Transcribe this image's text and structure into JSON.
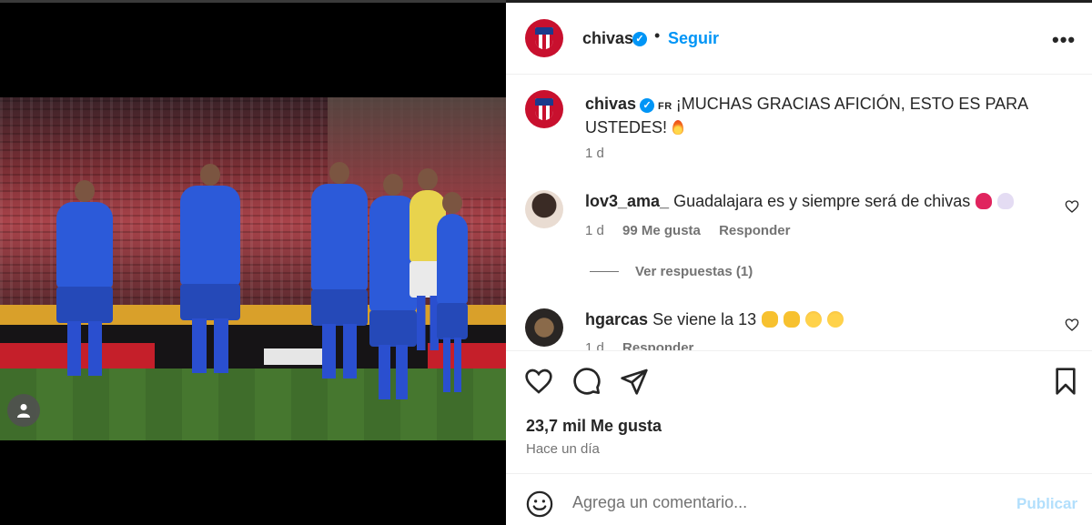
{
  "post": {
    "username": "chivas",
    "follow_label": "Seguir",
    "more_label": "•••",
    "caption_tag": "FR",
    "caption_text": "¡MUCHAS GRACIAS AFICIÓN, ESTO ES PARA USTEDES!",
    "caption_time": "1 d",
    "likes": "23,7 mil Me gusta",
    "posted": "Hace un día"
  },
  "comments": [
    {
      "username": "lov3_ama_",
      "text": "Guadalajara es y siempre será de chivas",
      "time": "1 d",
      "likes": "99 Me gusta",
      "reply_label": "Responder",
      "view_replies": "Ver respuestas (1)"
    },
    {
      "username": "hgarcas",
      "text": "Se viene la 13",
      "time": "1 d",
      "reply_label": "Responder"
    }
  ],
  "comment_box": {
    "placeholder": "Agrega un comentario...",
    "publish_label": "Publicar"
  },
  "colors": {
    "accent": "#0095f6",
    "brand": "#c8102e",
    "publish_disabled": "#b2dffc"
  }
}
